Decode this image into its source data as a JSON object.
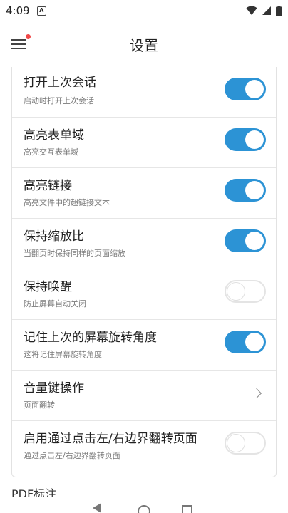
{
  "status": {
    "time": "4:09",
    "notif_letter": "A"
  },
  "header": {
    "title": "设置"
  },
  "settings": [
    {
      "title": "打开上次会话",
      "subtitle": "启动时打开上次会话",
      "control": "toggle",
      "on": true
    },
    {
      "title": "高亮表单域",
      "subtitle": "高亮交互表单域",
      "control": "toggle",
      "on": true
    },
    {
      "title": "高亮链接",
      "subtitle": "高亮文件中的超链接文本",
      "control": "toggle",
      "on": true
    },
    {
      "title": "保持缩放比",
      "subtitle": "当翻页时保持同样的页面缩放",
      "control": "toggle",
      "on": true
    },
    {
      "title": "保持唤醒",
      "subtitle": "防止屏幕自动关闭",
      "control": "toggle",
      "on": false
    },
    {
      "title": "记住上次的屏幕旋转角度",
      "subtitle": "这将记住屏幕旋转角度",
      "control": "toggle",
      "on": true
    },
    {
      "title": "音量键操作",
      "subtitle": "页面翻转",
      "control": "chevron"
    },
    {
      "title": "启用通过点击左/右边界翻转页面",
      "subtitle": "通过点击左/右边界翻转页面",
      "control": "toggle",
      "on": false
    }
  ],
  "next_section": {
    "label": "PDF标注"
  }
}
